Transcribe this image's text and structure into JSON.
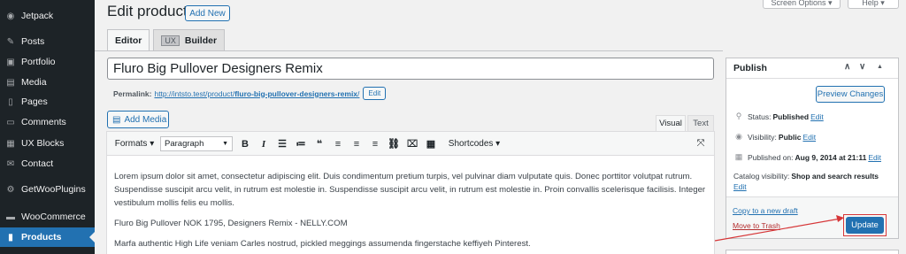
{
  "sidebar": {
    "items": [
      {
        "label": "Jetpack",
        "icon": "jetpack-icon",
        "glyph": "◉"
      },
      {
        "label": "Posts",
        "icon": "pushpin-icon",
        "glyph": "✎"
      },
      {
        "label": "Portfolio",
        "icon": "portfolio-icon",
        "glyph": "▣"
      },
      {
        "label": "Media",
        "icon": "media-icon",
        "glyph": "▤"
      },
      {
        "label": "Pages",
        "icon": "pages-icon",
        "glyph": "▯"
      },
      {
        "label": "Comments",
        "icon": "comments-icon",
        "glyph": "▭"
      },
      {
        "label": "UX Blocks",
        "icon": "blocks-icon",
        "glyph": "▦"
      },
      {
        "label": "Contact",
        "icon": "envelope-icon",
        "glyph": "✉"
      },
      {
        "label": "GetWooPlugins",
        "icon": "gear-icon",
        "glyph": "⚙"
      },
      {
        "label": "WooCommerce",
        "icon": "woocommerce-icon",
        "glyph": "▬"
      },
      {
        "label": "Products",
        "icon": "products-icon",
        "glyph": "▮"
      }
    ]
  },
  "header": {
    "title": "Edit product",
    "add_new": "Add New",
    "screen_options": "Screen Options ▾",
    "help": "Help ▾"
  },
  "editor_tabs": {
    "editor": "Editor",
    "ux_badge": "UX",
    "builder": "Builder"
  },
  "post": {
    "title": "Fluro Big Pullover Designers Remix",
    "permalink_label": "Permalink:",
    "permalink_base": "http://intsto.test/product/",
    "permalink_slug": "fluro-big-pullover-designers-remix",
    "permalink_end": "/",
    "permalink_edit": "Edit"
  },
  "editor": {
    "add_media": "Add Media",
    "tab_visual": "Visual",
    "tab_text": "Text",
    "formats": "Formats ▾",
    "paragraph": "Paragraph",
    "shortcodes": "Shortcodes ▾",
    "content": [
      "Lorem ipsum dolor sit amet, consectetur adipiscing elit. Duis condimentum pretium turpis, vel pulvinar diam vulputate quis. Donec porttitor volutpat rutrum. Suspendisse suscipit arcu velit, in rutrum est molestie in. Suspendisse suscipit arcu velit, in rutrum est molestie in. Proin convallis scelerisque facilisis. Integer vestibulum mollis felis eu mollis.",
      "Fluro Big Pullover NOK 1795, Designers Remix - NELLY.COM",
      "Marfa authentic High Life veniam Carles nostrud, pickled meggings assumenda fingerstache keffiyeh Pinterest."
    ]
  },
  "publish": {
    "title": "Publish",
    "preview": "Preview Changes",
    "status_label": "Status:",
    "status_value": "Published",
    "visibility_label": "Visibility:",
    "visibility_value": "Public",
    "published_label": "Published on:",
    "published_value": "Aug 9, 2014 at 21:11",
    "catalog_label": "Catalog visibility:",
    "catalog_value": "Shop and search results",
    "edit": "Edit",
    "copy_draft": "Copy to a new draft",
    "trash": "Move to Trash",
    "update": "Update"
  },
  "colors": {
    "accent": "#2271b1",
    "sidebar_bg": "#1d2327",
    "highlight": "#d63638"
  }
}
